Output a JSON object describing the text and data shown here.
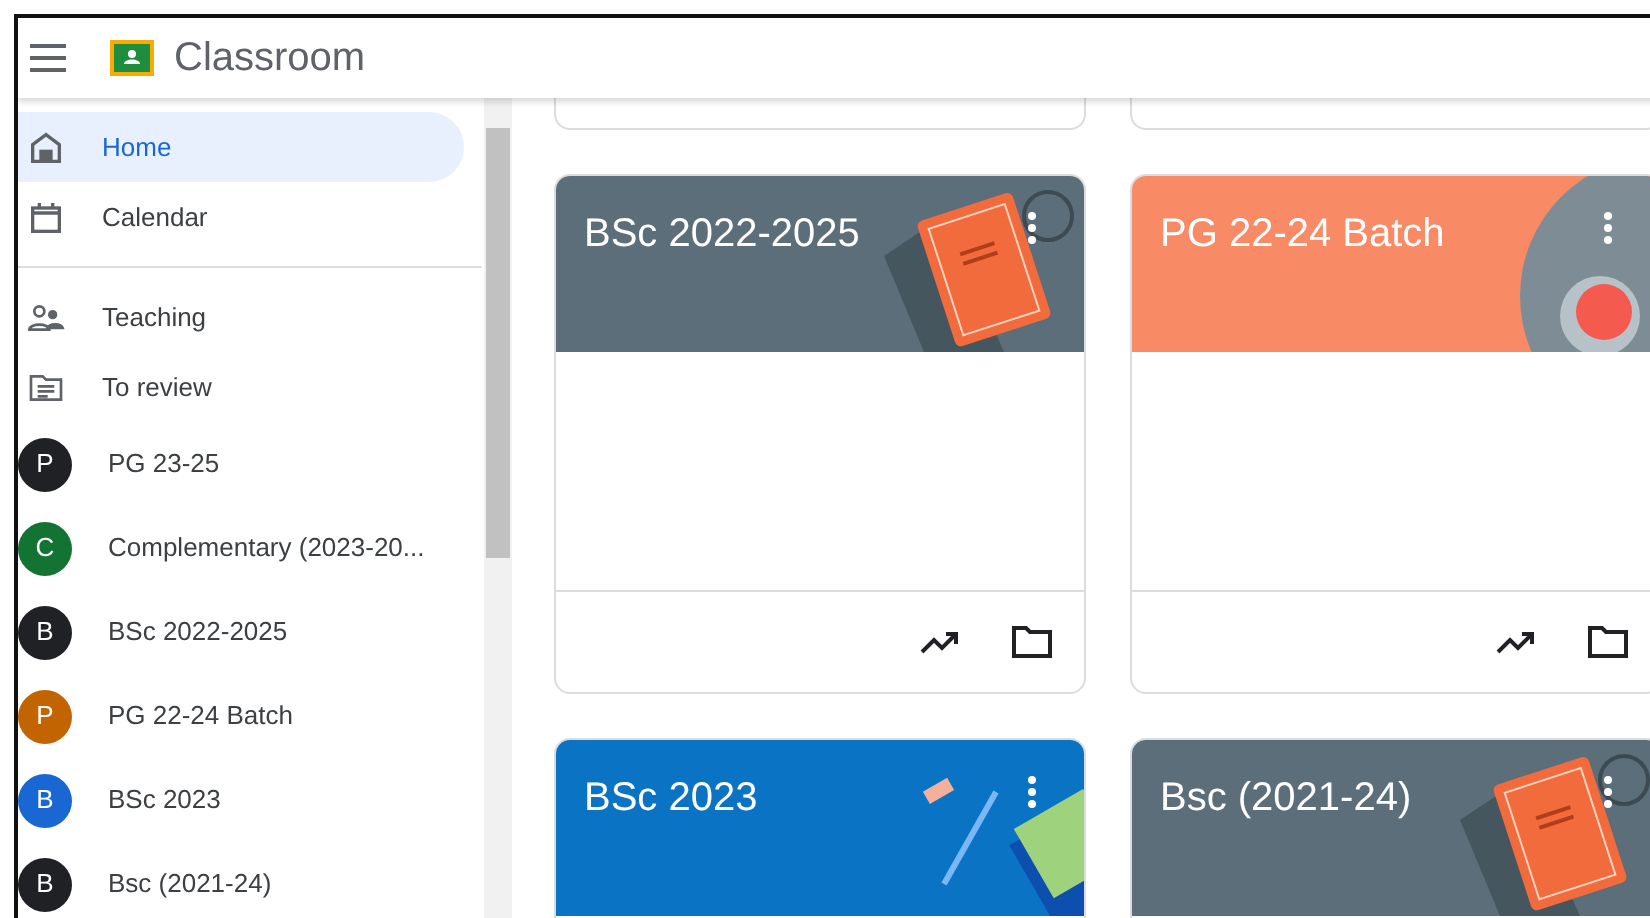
{
  "app": {
    "title": "Classroom"
  },
  "nav": [
    {
      "kind": "home",
      "label": "Home",
      "selected": true
    },
    {
      "kind": "calendar",
      "label": "Calendar",
      "selected": false
    },
    {
      "kind": "divider"
    },
    {
      "kind": "teaching",
      "label": "Teaching",
      "selected": false
    },
    {
      "kind": "review",
      "label": "To review",
      "selected": false
    },
    {
      "kind": "class",
      "letter": "P",
      "label": "PG 23-25",
      "color": "#202124",
      "selected": false
    },
    {
      "kind": "class",
      "letter": "C",
      "label": "Complementary (2023-20...",
      "color": "#137333",
      "selected": false
    },
    {
      "kind": "class",
      "letter": "B",
      "label": "BSc 2022-2025",
      "color": "#202124",
      "selected": false
    },
    {
      "kind": "class",
      "letter": "P",
      "label": "PG 22-24 Batch",
      "color": "#c26401",
      "selected": false
    },
    {
      "kind": "class",
      "letter": "B",
      "label": "BSc 2023",
      "color": "#1967d2",
      "selected": false
    },
    {
      "kind": "class",
      "letter": "B",
      "label": "Bsc (2021-24)",
      "color": "#202124",
      "selected": false
    }
  ],
  "cards": [
    {
      "title": "BSc 2022-2025",
      "color": "#5b6e7a",
      "kind": "book"
    },
    {
      "title": "PG 22-24 Batch",
      "color": "#f88a65",
      "kind": "cup"
    },
    {
      "title": "BSc 2023",
      "color": "#0a73c3",
      "kind": "pen"
    },
    {
      "title": "Bsc (2021-24)",
      "color": "#5b6e7a",
      "kind": "book"
    }
  ]
}
